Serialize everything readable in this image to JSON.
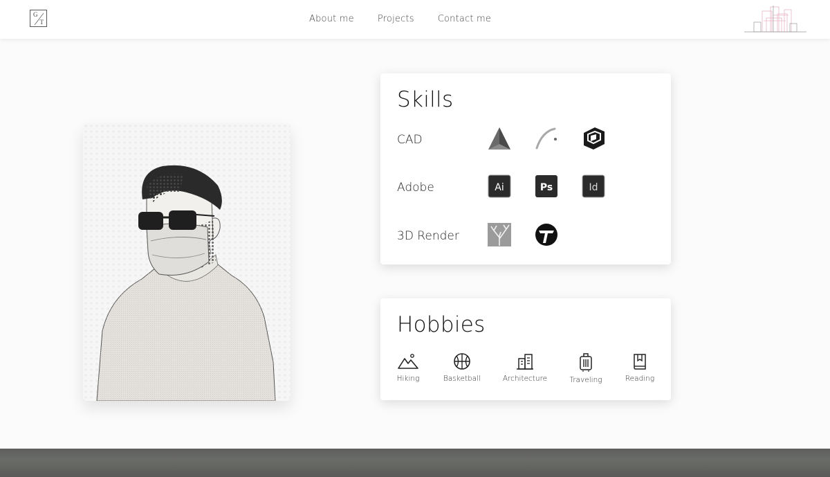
{
  "logo": {
    "top_letter": "G",
    "bottom_letter": "T"
  },
  "nav": {
    "items": [
      {
        "label": "About me"
      },
      {
        "label": "Projects"
      },
      {
        "label": "Contact me"
      }
    ]
  },
  "skills": {
    "title": "Skills",
    "rows": [
      {
        "label": "CAD",
        "icons": [
          "autocad-icon",
          "rhino-icon",
          "sketchup-icon"
        ]
      },
      {
        "label": "Adobe",
        "icons": [
          "illustrator-icon",
          "photoshop-icon",
          "indesign-icon"
        ],
        "icon_text": [
          "Ai",
          "Ps",
          "Id"
        ]
      },
      {
        "label": "3D Render",
        "icons": [
          "lumion-icon",
          "twinmotion-icon"
        ]
      }
    ]
  },
  "hobbies": {
    "title": "Hobbies",
    "items": [
      {
        "label": "Hiking",
        "icon": "mountain-icon"
      },
      {
        "label": "Basketball",
        "icon": "basketball-icon"
      },
      {
        "label": "Architecture",
        "icon": "building-icon"
      },
      {
        "label": "Traveling",
        "icon": "suitcase-icon"
      },
      {
        "label": "Reading",
        "icon": "book-icon"
      }
    ]
  },
  "colors": {
    "background": "#fbfbfb",
    "card": "#ffffff",
    "text": "#222222",
    "icon_dark": "#2b2b2b",
    "footer_band": "#5e5e5e"
  }
}
